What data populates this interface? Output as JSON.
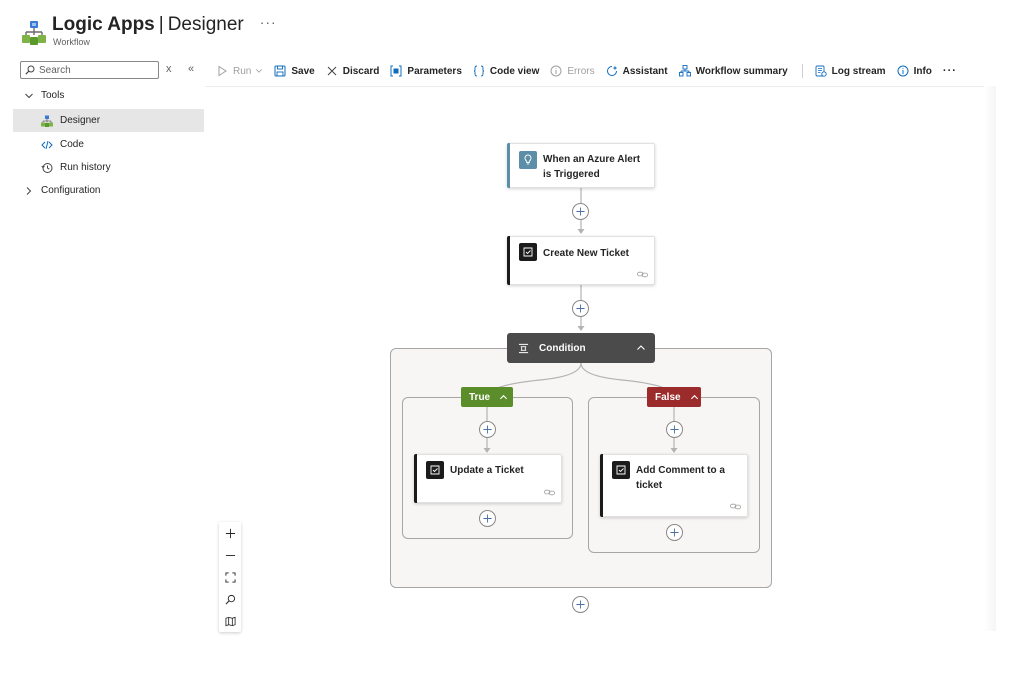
{
  "header": {
    "title": "Logic Apps",
    "separator": "|",
    "subtitle_part": "Designer",
    "more": "···",
    "resource_type": "Workflow"
  },
  "sidebar": {
    "search_placeholder": "Search",
    "clear": "x",
    "collapse": "«",
    "groups": [
      {
        "label": "Tools",
        "expanded": true
      },
      {
        "label": "Configuration",
        "expanded": false
      }
    ],
    "items": [
      {
        "label": "Designer",
        "selected": true,
        "icon": "designer-icon"
      },
      {
        "label": "Code",
        "selected": false,
        "icon": "code-icon"
      },
      {
        "label": "Run history",
        "selected": false,
        "icon": "history-icon"
      }
    ]
  },
  "toolbar": {
    "run": "Run",
    "save": "Save",
    "discard": "Discard",
    "parameters": "Parameters",
    "code_view": "Code view",
    "errors": "Errors",
    "assistant": "Assistant",
    "workflow_summary": "Workflow summary",
    "log_stream": "Log stream",
    "info": "Info",
    "more": "···"
  },
  "workflow": {
    "trigger": {
      "title_line1": "When an Azure Alert",
      "title_line2": "is Triggered",
      "icon": "alert-icon"
    },
    "action1": {
      "title": "Create New Ticket",
      "icon": "ticket-icon"
    },
    "condition": {
      "title": "Condition",
      "icon": "condition-icon"
    },
    "true_branch": {
      "label": "True",
      "action": {
        "title": "Update a Ticket",
        "icon": "ticket-icon"
      }
    },
    "false_branch": {
      "label": "False",
      "action": {
        "title_line1": "Add Comment to a",
        "title_line2": "ticket",
        "icon": "ticket-icon"
      }
    }
  },
  "colors": {
    "trigger_accent": "#5c8ea8",
    "action_accent": "#1b1b1b",
    "condition_header": "#4b4b4b",
    "true_label": "#5b8e2b",
    "false_label": "#9c2b2b",
    "selected_item": "#e6e6e6"
  },
  "zoom_controls": [
    "zoom-in-icon",
    "zoom-out-icon",
    "fit-view-icon",
    "zoom-search-icon",
    "minimap-icon"
  ]
}
